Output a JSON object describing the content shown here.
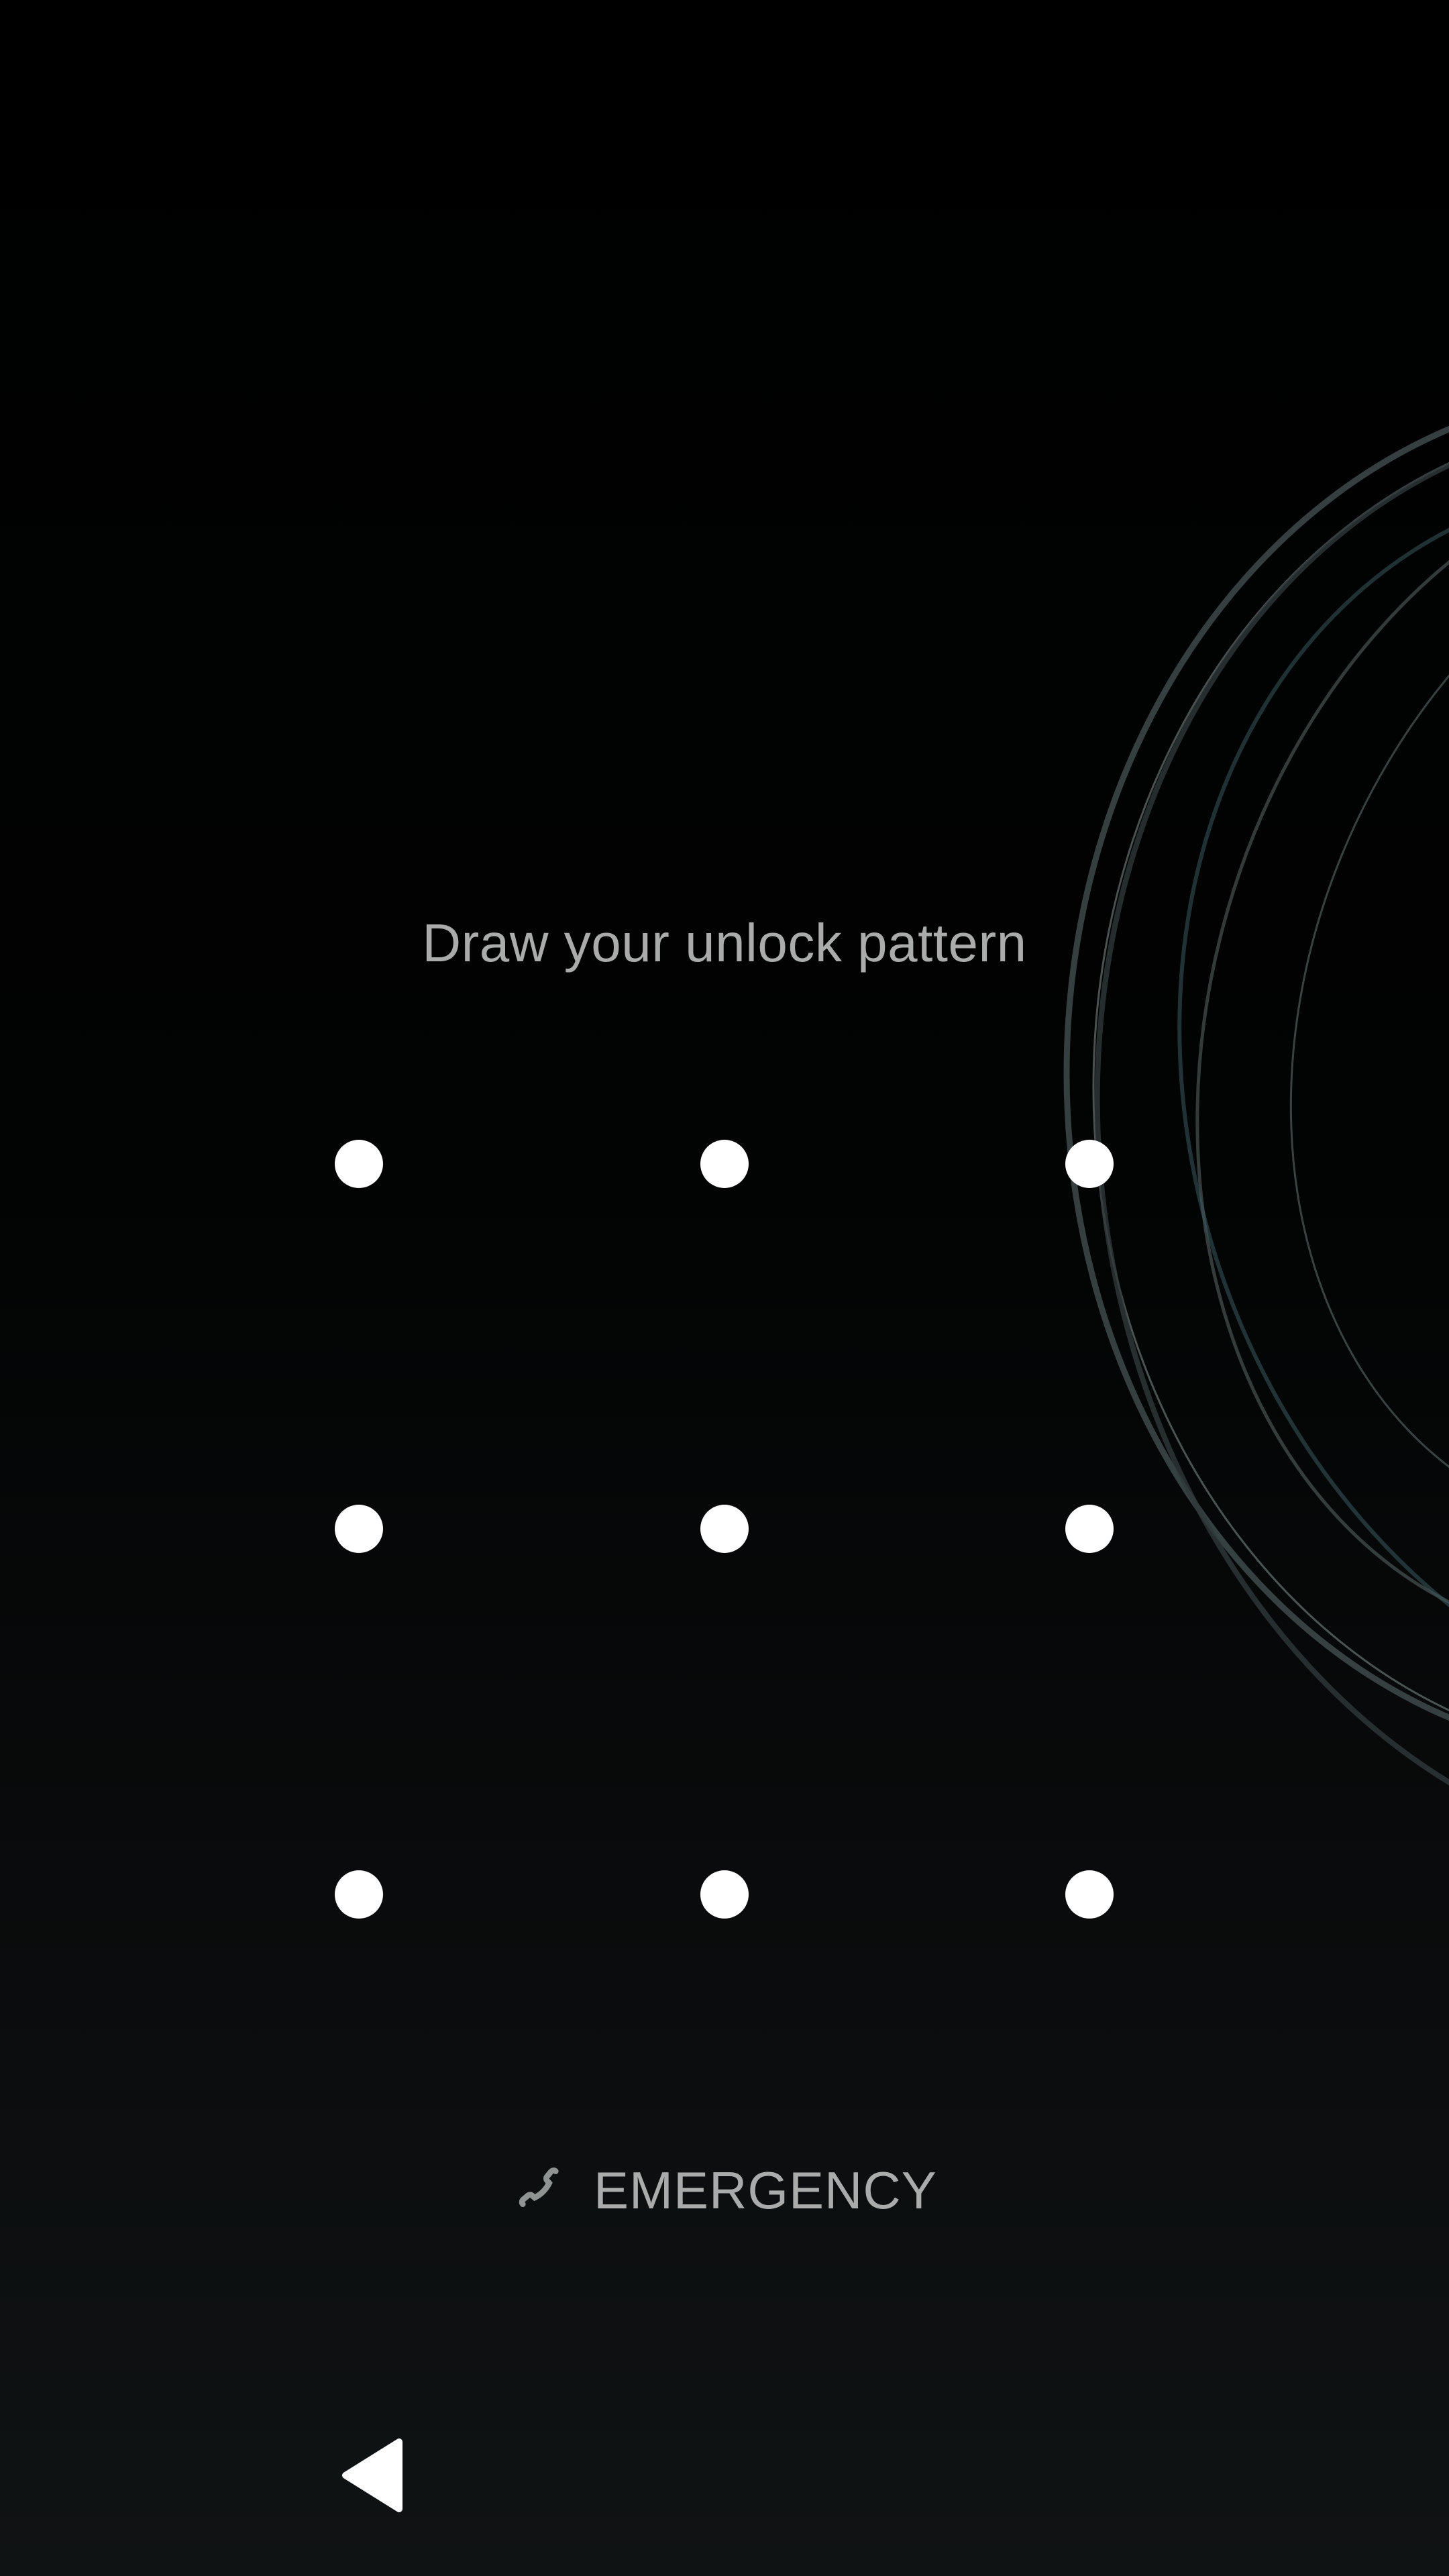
{
  "lock_screen": {
    "prompt": "Draw your unlock pattern",
    "pattern_dots": [
      {
        "name": "pattern-dot-1"
      },
      {
        "name": "pattern-dot-2"
      },
      {
        "name": "pattern-dot-3"
      },
      {
        "name": "pattern-dot-4"
      },
      {
        "name": "pattern-dot-5"
      },
      {
        "name": "pattern-dot-6"
      },
      {
        "name": "pattern-dot-7"
      },
      {
        "name": "pattern-dot-8"
      },
      {
        "name": "pattern-dot-9"
      }
    ],
    "emergency": {
      "label": "EMERGENCY",
      "icon": "phone-icon"
    }
  },
  "nav_bar": {
    "back_icon": "back-triangle-icon"
  },
  "colors": {
    "background_top": "#000000",
    "background_bottom": "#101314",
    "text": "#a9acaa",
    "dot": "#ffffff",
    "wallpaper_ring": "#4a5a5c"
  }
}
